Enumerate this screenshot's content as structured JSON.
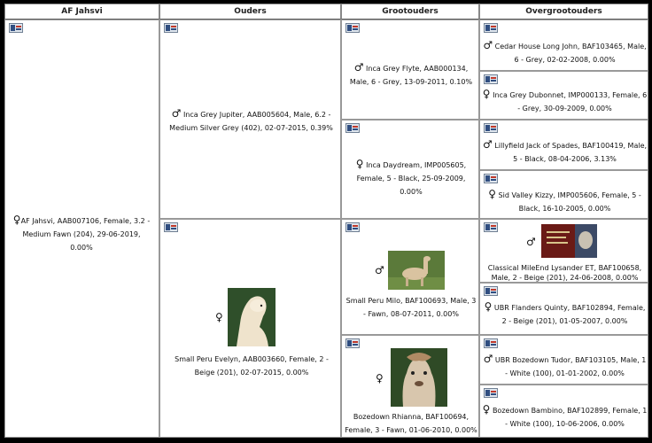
{
  "headers": [
    "AF Jahsvi",
    "Ouders",
    "Grootouders",
    "Overgrootouders"
  ],
  "symbols": {
    "male": "♂",
    "female": "♀"
  },
  "icons": {
    "card": "id-card-icon"
  },
  "subject": {
    "text": "AF Jahsvi, AAB007106, Female, 3.2 - Medium Fawn (204), 29-06-2019, 0.00%"
  },
  "parents": {
    "sire": {
      "text": "Inca Grey Jupiter, AAB005604, Male, 6.2 - Medium Silver Grey (402), 02-07-2015, 0.39%"
    },
    "dam": {
      "text": "Small Peru Evelyn, AAB003660, Female, 2 - Beige (201), 02-07-2015, 0.00%"
    }
  },
  "grandparents": {
    "sire_sire": {
      "text": "Inca Grey Flyte, AAB000134, Male, 6 - Grey, 13-09-2011, 0.10%"
    },
    "sire_dam": {
      "text": "Inca Daydream, IMP005605, Female, 5 - Black, 25-09-2009, 0.00%"
    },
    "dam_sire": {
      "text": "Small Peru Milo, BAF100693, Male, 3 - Fawn, 08-07-2011, 0.00%"
    },
    "dam_dam": {
      "text": "Bozedown Rhianna, BAF100694, Female, 3 - Fawn, 01-06-2010, 0.00%"
    }
  },
  "great_grandparents": [
    {
      "text": "Cedar House Long John, BAF103465, Male, 6 - Grey, 02-02-2008, 0.00%"
    },
    {
      "text": "Inca Grey Dubonnet, IMP000133, Female, 6 - Grey, 30-09-2009, 0.00%"
    },
    {
      "text": "Lillyfield Jack of Spades, BAF100419, Male, 5 - Black, 08-04-2006, 3.13%"
    },
    {
      "text": "Sid Valley Kizzy, IMP005606, Female, 5 - Black, 16-10-2005, 0.00%"
    },
    {
      "text": "Classical MileEnd Lysander ET, BAF100658, Male, 2 - Beige (201), 24-06-2008, 0.00%"
    },
    {
      "text": "UBR Flanders Quinty, BAF102894, Female, 2 - Beige (201), 01-05-2007, 0.00%"
    },
    {
      "text": "UBR Bozedown Tudor, BAF103105, Male, 1 - White (100), 01-01-2002, 0.00%"
    },
    {
      "text": "Bozedown Bambino, BAF102899, Female, 1 - White (100), 10-06-2006, 0.00%"
    }
  ]
}
